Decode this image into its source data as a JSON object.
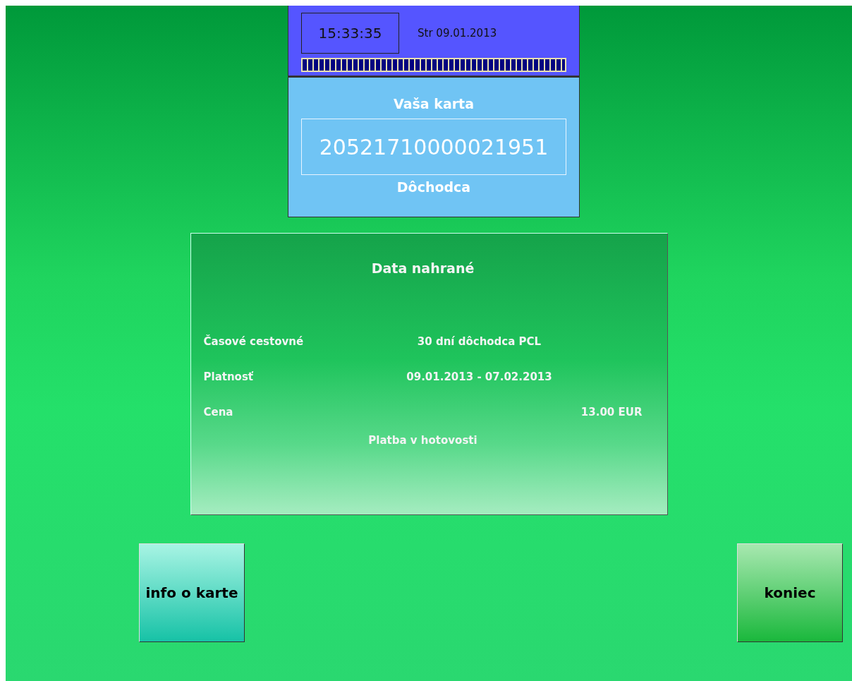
{
  "header": {
    "time": "15:33:35",
    "date": "Str 09.01.2013",
    "progress": {
      "level": 1
    }
  },
  "card": {
    "title": "Vaša karta",
    "number": "20521710000021951",
    "category": "Dôchodca"
  },
  "result": {
    "title": "Data nahrané",
    "rows": [
      {
        "label": "Časové cestovné",
        "value": "30 dní dôchodca PCL",
        "kind": "item"
      },
      {
        "label": "Platnosť",
        "value": "09.01.2013 - 07.02.2013",
        "kind": "item"
      },
      {
        "label": "Cena",
        "value": "13.00 EUR",
        "kind": "price"
      }
    ],
    "note": "Platba v hotovosti"
  },
  "buttons": [
    {
      "label": "info o karte",
      "kind": "info"
    },
    {
      "label": "koniec",
      "kind": "end"
    }
  ]
}
